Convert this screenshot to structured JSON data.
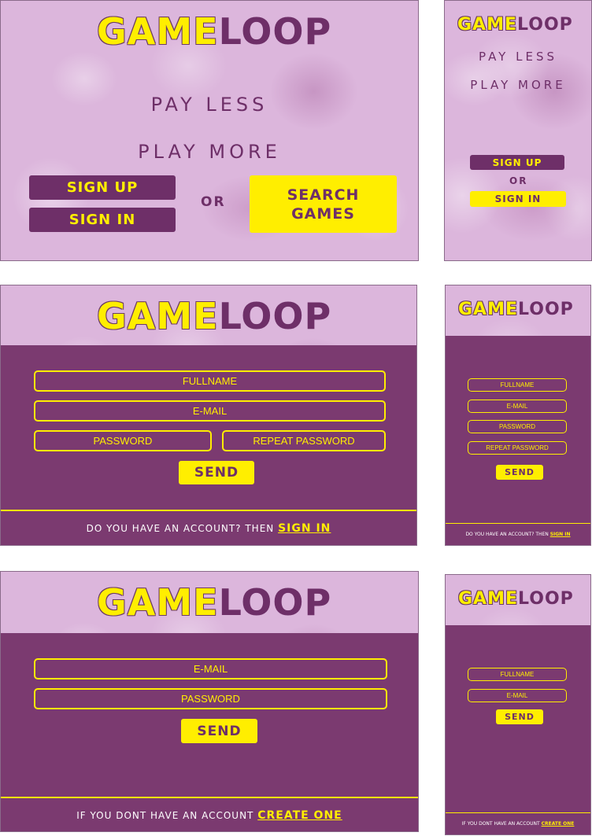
{
  "logo": {
    "part1": "GAME",
    "part2": "LOOP"
  },
  "landing": {
    "tagline1": "PAY LESS",
    "tagline2": "PLAY MORE",
    "signup": "SIGN UP",
    "signin": "SIGN IN",
    "or": "OR",
    "search": "SEARCH GAMES",
    "search_line1": "SEARCH",
    "search_line2": "GAMES"
  },
  "register": {
    "fullname": "FULLNAME",
    "email": "E-MAIL",
    "password": "PASSWORD",
    "repeat_password": "REPEAT PASSWORD",
    "send": "SEND",
    "footer_text": "DO YOU HAVE AN ACCOUNT? THEN",
    "footer_link": "SIGN IN"
  },
  "login": {
    "email": "E-MAIL",
    "password": "PASSWORD",
    "send": "SEND",
    "footer_text": "IF YOU DONT HAVE AN ACCOUNT",
    "footer_link": "CREATE ONE"
  },
  "login_mobile": {
    "fullname": "FULLNAME",
    "email": "E-MAIL",
    "send": "SEND"
  },
  "colors": {
    "purple": "#7b3a70",
    "yellow": "#ffee00",
    "pink": "#dcb6dc"
  }
}
